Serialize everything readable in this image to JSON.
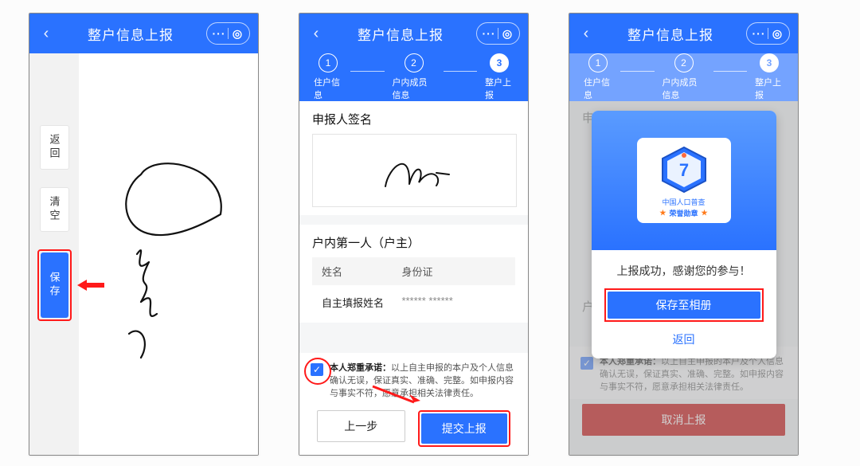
{
  "header": {
    "title": "整户信息上报",
    "back_glyph": "‹",
    "dots_glyph": "···",
    "ring_glyph": "◎"
  },
  "steps": {
    "a": {
      "num": "1",
      "label": "住户信息"
    },
    "b": {
      "num": "2",
      "label": "户内成员信息"
    },
    "c": {
      "num": "3",
      "label": "整户上报"
    }
  },
  "screen1": {
    "return_btn": "返回",
    "clear_btn": "清空",
    "save_btn": "保存"
  },
  "screen2": {
    "sign_title": "申报人签名",
    "owner_title": "户内第一人（户主）",
    "col_name": "姓名",
    "col_id": "身份证",
    "val_name": "自主填报姓名",
    "val_id": "******   ******",
    "promise_bold": "本人郑重承诺：",
    "promise_rest": "以上自主申报的本户及个人信息确认无误，保证真实、准确、完整。如申报内容与事实不符，愿意承担相关法律责任。",
    "prev_btn": "上一步",
    "submit_btn": "提交上报",
    "check_glyph": "✓"
  },
  "screen3": {
    "medal_num": "7",
    "medal_sub": "中国人口普查",
    "medal_ribbon": "荣誉勋章",
    "success_msg": "上报成功，感谢您的参与！",
    "save_album": "保存至相册",
    "return_link": "返回",
    "cancel_btn": "取消上报"
  }
}
